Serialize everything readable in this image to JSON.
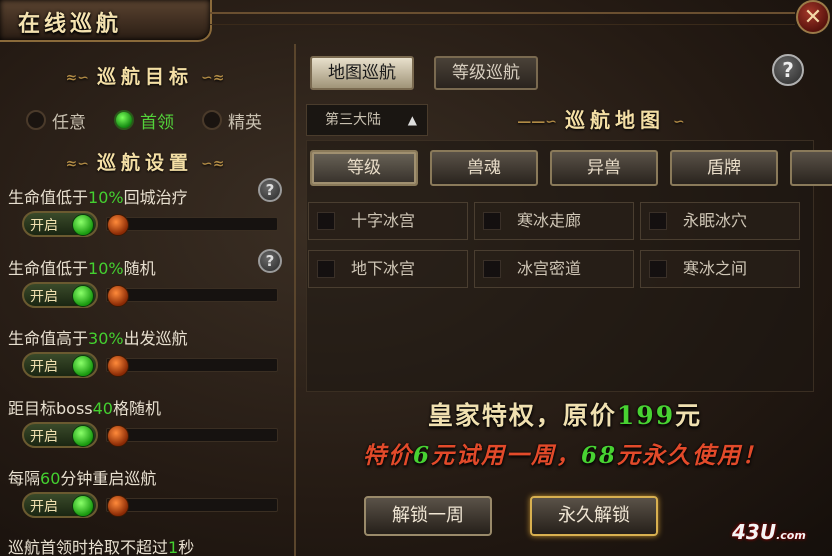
{
  "window": {
    "title": "在线巡航",
    "close_label": "✕"
  },
  "left": {
    "target_title": "巡航目标",
    "targets": [
      {
        "label": "任意",
        "selected": false
      },
      {
        "label": "首领",
        "selected": true
      },
      {
        "label": "精英",
        "selected": false
      }
    ],
    "settings_title": "巡航设置",
    "settings": [
      {
        "pre": "生命值低于",
        "value": "10%",
        "post": "回城治疗",
        "toggle": "开启",
        "help": "?"
      },
      {
        "pre": "生命值低于",
        "value": "10%",
        "post": "随机",
        "toggle": "开启",
        "help": "?"
      },
      {
        "pre": "生命值高于",
        "value": "30%",
        "post": "出发巡航",
        "toggle": "开启"
      },
      {
        "pre": "距目标boss",
        "value": "40",
        "post": "格随机",
        "toggle": "开启"
      },
      {
        "pre": "每隔",
        "value": "60",
        "post": "分钟重启巡航",
        "toggle": "开启"
      },
      {
        "pre": "巡航首领时拾取不超过",
        "value": "1",
        "post": "秒"
      }
    ]
  },
  "right": {
    "tabs": [
      {
        "label": "地图巡航"
      },
      {
        "label": "等级巡航"
      }
    ],
    "help": "?",
    "continent_select": "第三大陆",
    "map_title": "巡航地图",
    "categories": [
      {
        "label": "等级"
      },
      {
        "label": "兽魂"
      },
      {
        "label": "异兽"
      },
      {
        "label": "盾牌"
      }
    ],
    "maps": [
      {
        "label": "十字冰宫"
      },
      {
        "label": "寒冰走廊"
      },
      {
        "label": "永眠冰穴"
      },
      {
        "label": "地下冰宫"
      },
      {
        "label": "冰宫密道"
      },
      {
        "label": "寒冰之间"
      }
    ],
    "promo_line1_a": "皇家特权，原价",
    "promo_line1_price": "199",
    "promo_line1_b": "元",
    "promo_line2_a": "特价",
    "promo_line2_price": "6",
    "promo_line2_b": "元试用一周，",
    "promo_line2_price2": "68",
    "promo_line2_c": "元永久使用！",
    "buttons": [
      {
        "label": "解锁一周"
      },
      {
        "label": "永久解锁"
      }
    ]
  },
  "watermark": {
    "main": "43U",
    "small": ".com"
  }
}
